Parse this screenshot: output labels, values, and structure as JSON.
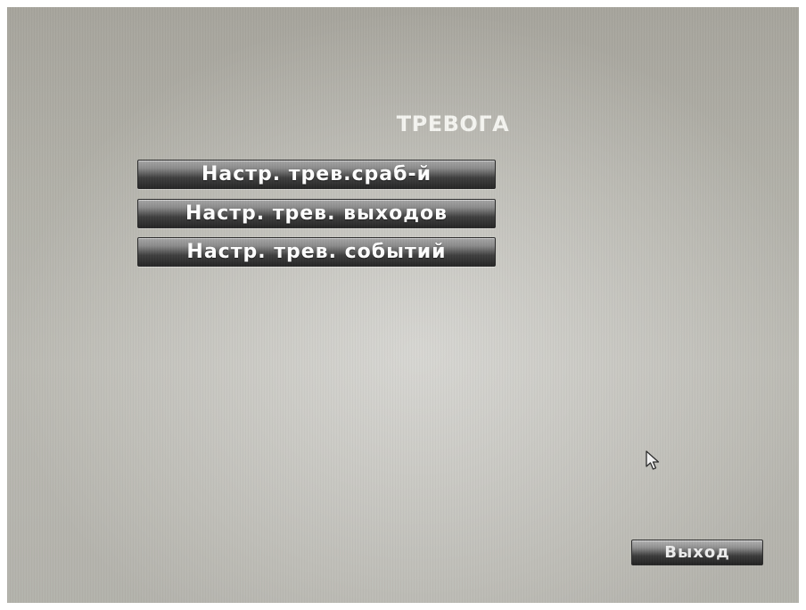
{
  "menu": {
    "title": "ТРЕВОГА",
    "items": [
      {
        "label": "Настр. трев.сраб-й"
      },
      {
        "label": "Настр. трев. выходов"
      },
      {
        "label": "Настр. трев. событий"
      }
    ]
  },
  "footer": {
    "exit_label": "Выход"
  },
  "cursor": {
    "icon": "arrow-pointer-icon"
  },
  "colors": {
    "background": "#b4b3ac",
    "button_dark": "#262626",
    "text": "#ffffff"
  }
}
